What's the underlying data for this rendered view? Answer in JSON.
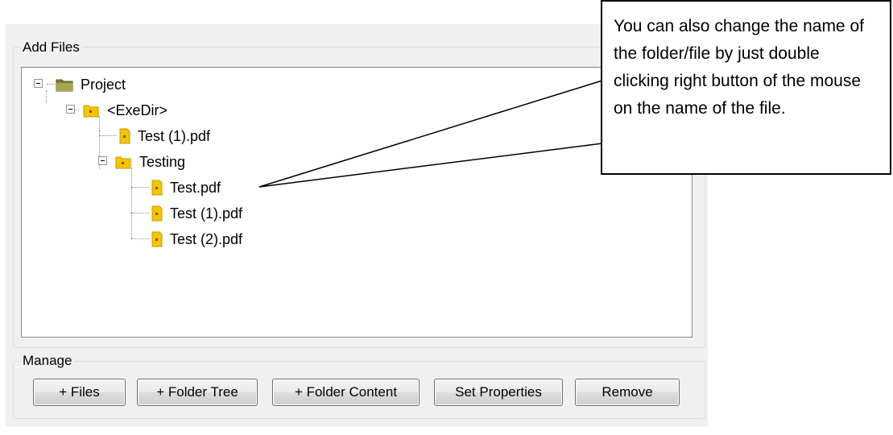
{
  "add_files_group": {
    "label": "Add Files"
  },
  "tree": {
    "nodes": [
      {
        "label": "Project",
        "kind": "root-folder",
        "icon": "folder-icon",
        "expanded": true
      },
      {
        "label": "<ExeDir>",
        "kind": "folder",
        "icon": "folder-icon",
        "expanded": true
      },
      {
        "label": "Test (1).pdf",
        "kind": "file",
        "icon": "file-icon"
      },
      {
        "label": "Testing",
        "kind": "folder",
        "icon": "folder-icon",
        "expanded": true
      },
      {
        "label": "Test.pdf",
        "kind": "file",
        "icon": "file-icon"
      },
      {
        "label": "Test (1).pdf",
        "kind": "file",
        "icon": "file-icon"
      },
      {
        "label": "Test (2).pdf",
        "kind": "file",
        "icon": "file-icon"
      }
    ]
  },
  "manage_group": {
    "label": "Manage",
    "buttons": [
      {
        "label": "+ Files"
      },
      {
        "label": "+ Folder Tree"
      },
      {
        "label": "+ Folder Content"
      },
      {
        "label": "Set Properties"
      },
      {
        "label": "Remove"
      }
    ]
  },
  "callout": {
    "text": "You can also change the name of the folder/file by just double clicking right button of the mouse on the name of the file."
  },
  "colors": {
    "folder": "#f5c400",
    "root_folder": "#8b8a3a",
    "border": "#828790",
    "panel": "#f0f0f0"
  }
}
